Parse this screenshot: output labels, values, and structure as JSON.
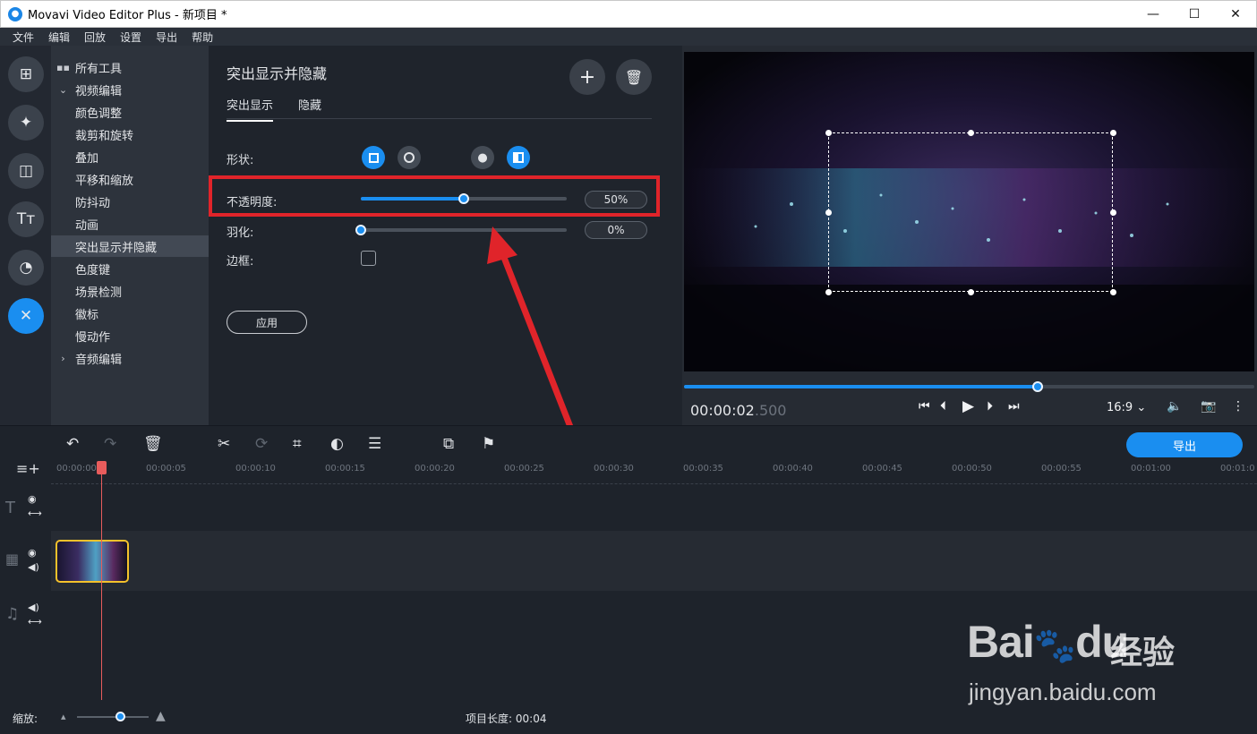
{
  "window": {
    "title": "Movavi Video Editor Plus - 新项目 *",
    "app_icon": "movavi-logo-icon",
    "controls": [
      "minimize-icon",
      "maximize-icon",
      "close-icon"
    ]
  },
  "menu": [
    "文件",
    "编辑",
    "回放",
    "设置",
    "导出",
    "帮助"
  ],
  "rail": {
    "icons": [
      "import-icon",
      "magic-wand-icon",
      "transitions-icon",
      "titles-icon",
      "filters-icon",
      "tools-icon"
    ],
    "active_index": 5
  },
  "tools": {
    "all_tools": "所有工具",
    "video_group": "视频编辑",
    "items": [
      "颜色调整",
      "裁剪和旋转",
      "叠加",
      "平移和缩放",
      "防抖动",
      "动画",
      "突出显示并隐藏",
      "色度键",
      "场景检测",
      "徽标",
      "慢动作"
    ],
    "selected": "突出显示并隐藏",
    "audio_group": "音频编辑"
  },
  "props": {
    "title": "突出显示并隐藏",
    "tabs": [
      "突出显示",
      "隐藏"
    ],
    "active_tab": 0,
    "shape_label": "形状:",
    "opacity_label": "不透明度:",
    "opacity_value": "50%",
    "opacity_level": 0.5,
    "feather_label": "羽化:",
    "feather_value": "0%",
    "feather_level": 0,
    "border_label": "边框:",
    "apply_label": "应用"
  },
  "preview": {
    "time_main": "00:00:02",
    "time_ms": ".500",
    "aspect": "16:9",
    "progress": 0.62
  },
  "timeline": {
    "export_label": "导出",
    "ruler": [
      "00:00:00",
      "00:00:05",
      "00:00:10",
      "00:00:15",
      "00:00:20",
      "00:00:25",
      "00:00:30",
      "00:00:35",
      "00:00:40",
      "00:00:45",
      "00:00:50",
      "00:00:55",
      "00:01:00",
      "00:01:0"
    ]
  },
  "status": {
    "zoom_label": "缩放:",
    "project_length_label": "项目长度:",
    "project_length": "00:04"
  },
  "watermark": {
    "brand": "Bai",
    "brand2": "du",
    "cn": "经验",
    "url": "jingyan.baidu.com"
  }
}
